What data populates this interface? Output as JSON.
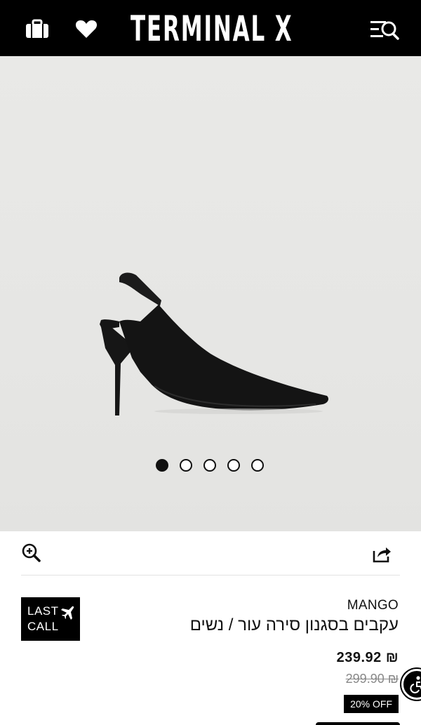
{
  "header": {
    "logo_text": "TERMINAL X",
    "icons": [
      "bag-icon",
      "heart-icon",
      "search-menu-icon"
    ]
  },
  "gallery": {
    "image_alt": "black slingback pointed heel",
    "slide_count": 5,
    "active_slide": 1
  },
  "tools": {
    "icons": [
      "zoom-in-icon",
      "share-icon"
    ]
  },
  "badge": {
    "line1": "LAST",
    "line2": "CALL",
    "icon": "airplane-icon"
  },
  "product": {
    "brand": "MANGO",
    "title": "עקבים בסגנון סירה עור / נשים",
    "price": "239.92 ₪",
    "old_price": "299.90 ₪",
    "discount": "20% OFF"
  },
  "accessibility": {
    "icon": "accessibility-icon"
  },
  "colors": {
    "header_bg": "#000000",
    "gallery_bg": "#e7e7e5",
    "accent": "#000000"
  }
}
